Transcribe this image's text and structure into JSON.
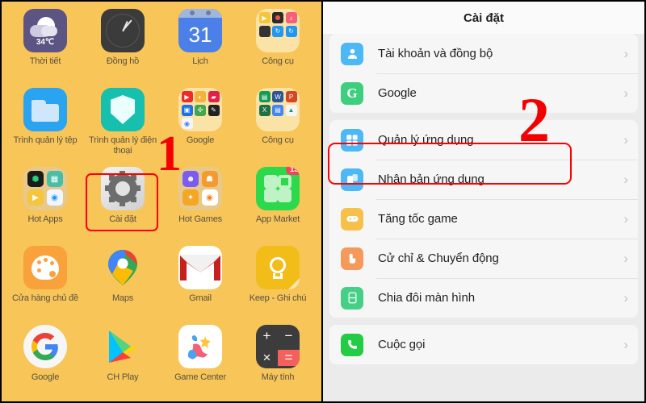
{
  "home": {
    "background_color": "#f7c558",
    "apps": [
      {
        "label": "Thời tiết",
        "icon": "weather-icon",
        "temp": "34℃"
      },
      {
        "label": "Đồng hồ",
        "icon": "clock-icon"
      },
      {
        "label": "Lịch",
        "icon": "calendar-icon",
        "day": "31"
      },
      {
        "label": "Công cụ",
        "icon": "tools-folder-icon"
      },
      {
        "label": "Trình quản lý tệp",
        "icon": "file-manager-icon"
      },
      {
        "label": "Trình quản lý điện thoại",
        "icon": "phone-manager-icon"
      },
      {
        "label": "Google",
        "icon": "google-folder-icon"
      },
      {
        "label": "Công cụ",
        "icon": "office-folder-icon"
      },
      {
        "label": "Hot Apps",
        "icon": "hot-apps-folder-icon"
      },
      {
        "label": "Cài đặt",
        "icon": "settings-gear-icon"
      },
      {
        "label": "Hot Games",
        "icon": "hot-games-folder-icon"
      },
      {
        "label": "App Market",
        "icon": "app-market-icon",
        "badge": "15"
      },
      {
        "label": "Cửa hàng chủ đề",
        "icon": "theme-store-icon"
      },
      {
        "label": "Maps",
        "icon": "maps-icon"
      },
      {
        "label": "Gmail",
        "icon": "gmail-icon"
      },
      {
        "label": "Keep - Ghi chú",
        "icon": "keep-notes-icon"
      },
      {
        "label": "Google",
        "icon": "google-search-icon"
      },
      {
        "label": "CH Play",
        "icon": "play-store-icon"
      },
      {
        "label": "Game Center",
        "icon": "game-center-icon"
      },
      {
        "label": "Máy tính",
        "icon": "calculator-icon"
      }
    ]
  },
  "annotations": {
    "step_one": "1",
    "step_two": "2",
    "highlight_color": "#ff0000"
  },
  "settings": {
    "title": "Cài đặt",
    "chevron": "›",
    "groups": [
      {
        "rows": [
          {
            "label": "Tài khoản và đồng bộ",
            "icon": "account-sync-icon",
            "color": "#4cb8f5"
          },
          {
            "label": "Google",
            "icon": "google-icon",
            "color": "#3ecf7e"
          }
        ]
      },
      {
        "rows": [
          {
            "label": "Quản lý ứng dụng",
            "icon": "app-management-icon",
            "color": "#4cb8f5",
            "highlighted": true
          },
          {
            "label": "Nhân bản ứng dụng",
            "icon": "app-clone-icon",
            "color": "#4cb8f5"
          },
          {
            "label": "Tăng tốc game",
            "icon": "game-boost-icon",
            "color": "#f7c04a"
          },
          {
            "label": "Cử chỉ & Chuyển động",
            "icon": "gestures-motion-icon",
            "color": "#f59a5a"
          },
          {
            "label": "Chia đôi màn hình",
            "icon": "split-screen-icon",
            "color": "#45cf87"
          }
        ]
      },
      {
        "rows": [
          {
            "label": "Cuộc gọi",
            "icon": "phone-call-icon",
            "color": "#22cc44"
          }
        ]
      }
    ]
  }
}
